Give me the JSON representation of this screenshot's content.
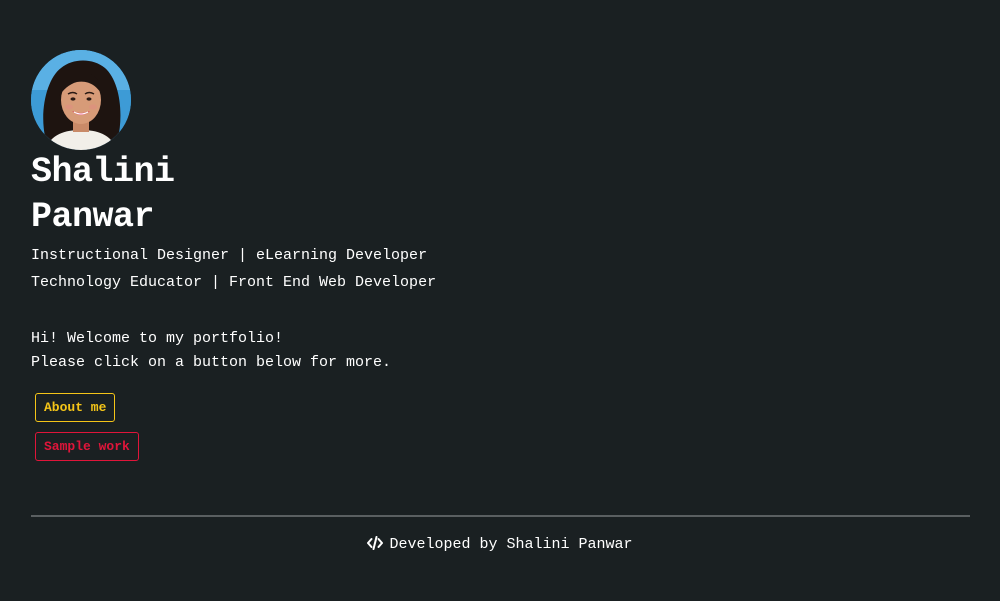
{
  "profile": {
    "avatar_alt": "Shalini Panwar",
    "first_name": "Shalini",
    "last_name": "Panwar",
    "roles": [
      "Instructional Designer | eLearning Developer",
      "Technology Educator | Front End Web Developer"
    ]
  },
  "intro": {
    "line1": "Hi! Welcome to my portfolio!",
    "line2": "Please click on a button below for more."
  },
  "buttons": {
    "about": "About me",
    "work": "Sample work"
  },
  "footer": {
    "icon": "code-icon",
    "text": "Developed by Shalini Panwar"
  },
  "colors": {
    "background": "#1a2022",
    "about_accent": "#f5c518",
    "work_accent": "#e0153a"
  }
}
